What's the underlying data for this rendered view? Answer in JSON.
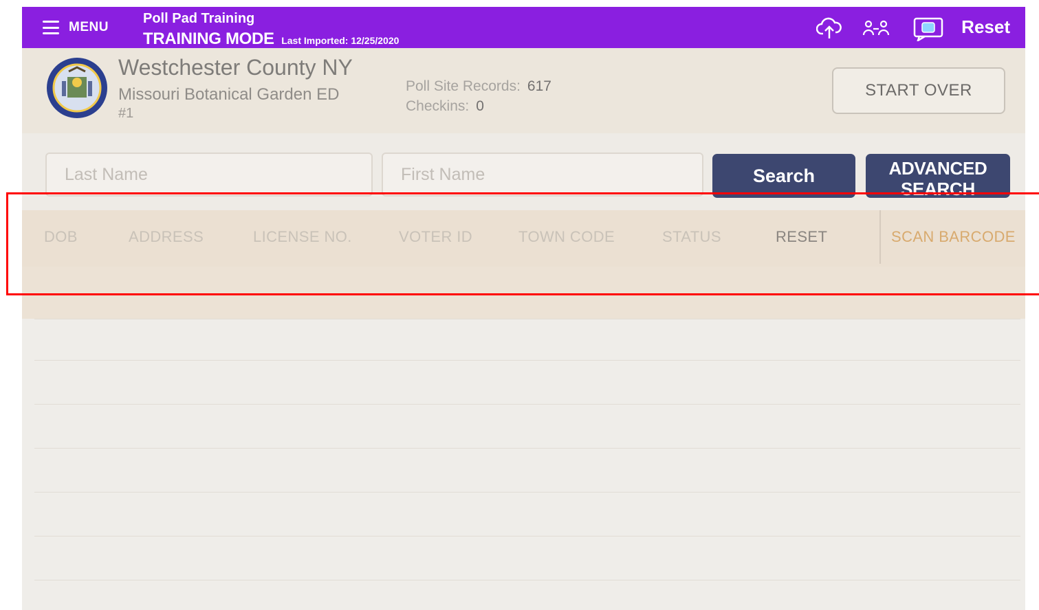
{
  "topbar": {
    "menu_label": "MENU",
    "app_title": "Poll Pad Training",
    "mode_title": "TRAINING MODE",
    "last_imported": "Last Imported: 12/25/2020",
    "reset_label": "Reset",
    "icons": [
      "cloud-upload-icon",
      "users-swap-icon",
      "chat-icon"
    ]
  },
  "header": {
    "county": "Westchester County NY",
    "site_name": "Missouri Botanical Garden ED",
    "site_number": "#1",
    "poll_site_records_label": "Poll Site Records:",
    "poll_site_records": "617",
    "checkins_label": "Checkins:",
    "checkins": "0",
    "start_over_label": "START OVER"
  },
  "search": {
    "last_name_placeholder": "Last Name",
    "first_name_placeholder": "First Name",
    "search_label": "Search",
    "advanced_label": "ADVANCED SEARCH"
  },
  "filters": {
    "dob": "DOB",
    "address": "ADDRESS",
    "license": "LICENSE NO.",
    "voter_id": "VOTER ID",
    "town_code": "TOWN CODE",
    "status": "STATUS",
    "reset": "RESET",
    "scan_barcode": "SCAN BARCODE"
  },
  "colors": {
    "topbar": "#8a1fe0",
    "button_dark": "#3d4770",
    "scan_accent": "#d8aa6e",
    "highlight": "#ff0000"
  }
}
